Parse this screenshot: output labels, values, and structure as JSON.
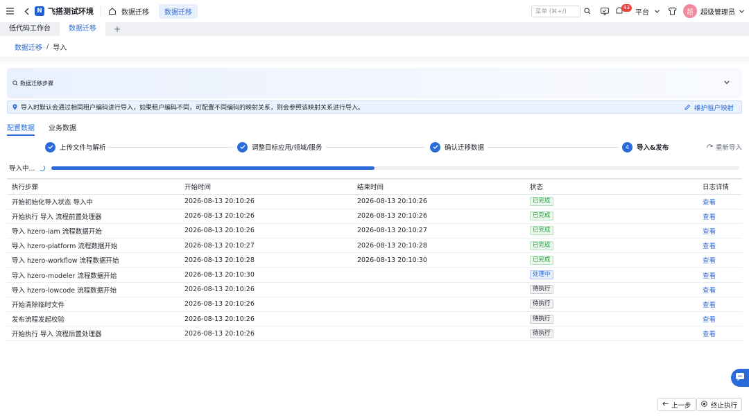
{
  "topbar": {
    "app_name": "飞搭测试环境",
    "logo_glyph": "N",
    "home_crumb": "数据迁移",
    "active_tab": "数据迁移",
    "search_placeholder": "菜单 (⌘+/)",
    "notification_count": "43",
    "platform_label": "平台",
    "avatar_text": "超",
    "user_name": "超级管理员"
  },
  "tabs": {
    "items": [
      "低代码工作台",
      "数据迁移"
    ],
    "active": "数据迁移",
    "add_label": "+"
  },
  "breadcrumb": {
    "parent": "数据迁移",
    "separator": "/",
    "current": "导入"
  },
  "panel": {
    "title": "数据迁移步骤"
  },
  "notice": {
    "text": "导入时默认会通过相同租户编码进行导入，如果租户编码不同，可配置不同编码的映射关系，则会参照该映射关系进行导入。",
    "action": "维护租户映射"
  },
  "subtabs": [
    "配置数据",
    "业务数据"
  ],
  "steps": [
    {
      "label": "上传文件与解析",
      "state": "done"
    },
    {
      "label": "调整目标应用/领域/服务",
      "state": "done"
    },
    {
      "label": "确认迁移数据",
      "state": "done"
    },
    {
      "label": "导入&发布",
      "state": "current",
      "number": "4"
    }
  ],
  "restart_label": "重新导入",
  "progress": {
    "label": "导入中...",
    "percent": 47
  },
  "table": {
    "columns": [
      "执行步骤",
      "开始时间",
      "结束时间",
      "状态",
      "日志详情"
    ],
    "rows": [
      {
        "step": "开始初始化导入状态 导入中",
        "start": "2026-08-13 20:10:26",
        "end": "2026-08-13 20:10:26",
        "status": "已完成",
        "kind": "done",
        "log": "查看"
      },
      {
        "step": "开始执行 导入 流程前置处理器",
        "start": "2026-08-13 20:10:26",
        "end": "2026-08-13 20:10:26",
        "status": "已完成",
        "kind": "done",
        "log": "查看"
      },
      {
        "step": "导入 hzero-iam 流程数据开始",
        "start": "2026-08-13 20:10:26",
        "end": "2026-08-13 20:10:27",
        "status": "已完成",
        "kind": "done",
        "log": "查看"
      },
      {
        "step": "导入 hzero-platform 流程数据开始",
        "start": "2026-08-13 20:10:27",
        "end": "2026-08-13 20:10:28",
        "status": "已完成",
        "kind": "done",
        "log": "查看"
      },
      {
        "step": "导入 hzero-workflow 流程数据开始",
        "start": "2026-08-13 20:10:28",
        "end": "2026-08-13 20:10:30",
        "status": "已完成",
        "kind": "done",
        "log": "查看"
      },
      {
        "step": "导入 hzero-modeler 流程数据开始",
        "start": "2026-08-13 20:10:30",
        "end": "",
        "status": "处理中",
        "kind": "running",
        "log": "查看"
      },
      {
        "step": "导入 hzero-lowcode 流程数据开始",
        "start": "2026-08-13 20:10:26",
        "end": "",
        "status": "待执行",
        "kind": "waiting",
        "log": "查看"
      },
      {
        "step": "开始清除临时文件",
        "start": "2026-08-13 20:10:26",
        "end": "",
        "status": "待执行",
        "kind": "waiting",
        "log": "查看"
      },
      {
        "step": "发布流程发起校验",
        "start": "2026-08-13 20:10:26",
        "end": "",
        "status": "待执行",
        "kind": "waiting",
        "log": "查看"
      },
      {
        "step": "开始执行 导入 流程后置处理器",
        "start": "2026-08-13 20:10:26",
        "end": "",
        "status": "待执行",
        "kind": "waiting",
        "log": "查看"
      }
    ]
  },
  "footer": {
    "prev_label": "上一步",
    "stop_label": "终止执行"
  },
  "colors": {
    "primary": "#2b6bd9",
    "success": "#2e9b45",
    "badge": "#e8453c"
  }
}
